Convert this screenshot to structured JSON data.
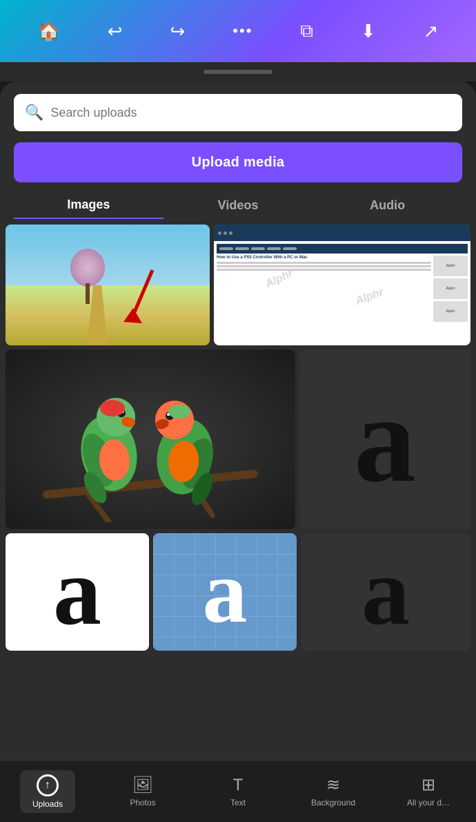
{
  "topbar": {
    "icons": [
      "home",
      "undo",
      "redo",
      "more",
      "copy",
      "download",
      "share"
    ]
  },
  "search": {
    "placeholder": "Search uploads"
  },
  "upload_button": {
    "label": "Upload media"
  },
  "tabs": [
    {
      "label": "Images",
      "active": true
    },
    {
      "label": "Videos",
      "active": false
    },
    {
      "label": "Audio",
      "active": false
    }
  ],
  "bottom_nav": [
    {
      "label": "Uploads",
      "active": true
    },
    {
      "label": "Photos",
      "active": false
    },
    {
      "label": "Text",
      "active": false
    },
    {
      "label": "Background",
      "active": false
    },
    {
      "label": "All your d…",
      "active": false
    }
  ],
  "images": {
    "row1": [
      {
        "type": "landscape",
        "alt": "Spring field with blossoming trees"
      },
      {
        "type": "website",
        "alt": "Alphr website screenshot"
      }
    ],
    "row2": [
      {
        "type": "parrots",
        "alt": "Two colorful lovebirds on a branch"
      },
      {
        "type": "letter-a",
        "style": "black",
        "alt": "Letter A black"
      }
    ],
    "row3": [
      {
        "type": "letter-a",
        "style": "white-bg",
        "alt": "Letter A white background"
      },
      {
        "type": "letter-a",
        "style": "pattern",
        "alt": "Letter A with pattern"
      },
      {
        "type": "letter-a",
        "style": "dark",
        "alt": "Letter A dark"
      }
    ]
  }
}
